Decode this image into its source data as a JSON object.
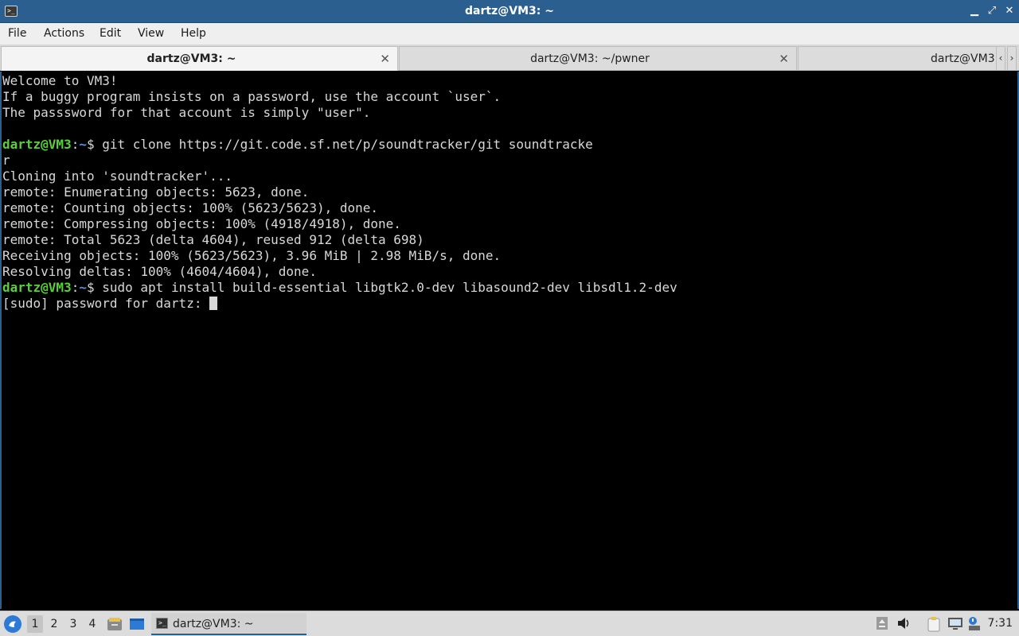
{
  "window": {
    "title": "dartz@VM3: ~",
    "minimize_glyph": "▁",
    "maximize_glyph": "⤢",
    "close_glyph": "✕"
  },
  "menu": [
    "File",
    "Actions",
    "Edit",
    "View",
    "Help"
  ],
  "tabs": [
    {
      "label": "dartz@VM3: ~",
      "close": "✕"
    },
    {
      "label": "dartz@VM3: ~/pwner",
      "close": "✕"
    },
    {
      "label": "dartz@VM3"
    }
  ],
  "tab_scroll": {
    "left": "‹",
    "right": "›"
  },
  "terminal": {
    "prompt_user": "dartz@VM3",
    "prompt_sep": ":",
    "prompt_path": "~",
    "prompt_dollar": "$ ",
    "lines": [
      "Welcome to VM3!",
      "If a buggy program insists on a password, use the account `user`.",
      "The passsword for that account is simply \"user\".",
      ""
    ],
    "cmd1": "git clone https://git.code.sf.net/p/soundtracker/git soundtracke",
    "output1": [
      "r",
      "Cloning into 'soundtracker'...",
      "remote: Enumerating objects: 5623, done.",
      "remote: Counting objects: 100% (5623/5623), done.",
      "remote: Compressing objects: 100% (4918/4918), done.",
      "remote: Total 5623 (delta 4604), reused 912 (delta 698)",
      "Receiving objects: 100% (5623/5623), 3.96 MiB | 2.98 MiB/s, done.",
      "Resolving deltas: 100% (4604/4604), done."
    ],
    "cmd2": "sudo apt install build-essential libgtk2.0-dev libasound2-dev libsdl1.2-dev",
    "sudo_prompt": "[sudo] password for dartz: "
  },
  "panel": {
    "workspaces": [
      "1",
      "2",
      "3",
      "4"
    ],
    "active_workspace": "1",
    "task": "dartz@VM3: ~",
    "clock": "7:31",
    "tray_icons": [
      "upload-icon",
      "volume-icon",
      "clipboard-icon",
      "network-icon",
      "notification-icon"
    ]
  }
}
